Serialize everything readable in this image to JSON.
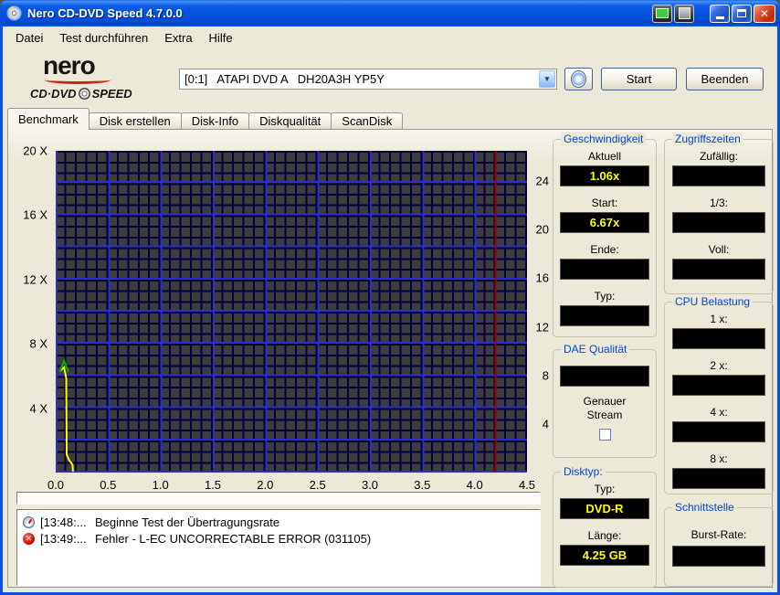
{
  "window": {
    "title": "Nero CD-DVD Speed 4.7.0.0"
  },
  "menu": {
    "items": [
      "Datei",
      "Test durchführen",
      "Extra",
      "Hilfe"
    ]
  },
  "logo": {
    "brand": "nero",
    "sub1": "CD·DVD",
    "sub2": "SPEED"
  },
  "toolbar": {
    "drive": "[0:1]   ATAPI DVD A   DH20A3H YP5Y",
    "start": "Start",
    "quit": "Beenden"
  },
  "tabs": [
    "Benchmark",
    "Disk erstellen",
    "Disk-Info",
    "Diskqualität",
    "ScanDisk"
  ],
  "colors": {
    "titlebar": "#0054e3",
    "group_caption": "#0046d5",
    "value_text": "#ffff00",
    "plot_background": "#3c3c3c",
    "grid_minor": "#00003c",
    "grid_major": "#2e2ec8",
    "error": "#c80000"
  },
  "chart_data": {
    "type": "line",
    "title": "",
    "x_axis": {
      "min": 0,
      "max": 4.5,
      "ticks": [
        {
          "label": "0.0",
          "value": 0.0
        },
        {
          "label": "0.5",
          "value": 0.5
        },
        {
          "label": "1.0",
          "value": 1.0
        },
        {
          "label": "1.5",
          "value": 1.5
        },
        {
          "label": "2.0",
          "value": 2.0
        },
        {
          "label": "2.5",
          "value": 2.5
        },
        {
          "label": "3.0",
          "value": 3.0
        },
        {
          "label": "3.5",
          "value": 3.5
        },
        {
          "label": "4.0",
          "value": 4.0
        },
        {
          "label": "4.5",
          "value": 4.5
        }
      ]
    },
    "left_axis": {
      "min": 0,
      "max": 20,
      "unit": "X",
      "ticks": [
        {
          "label": "20 X",
          "value": 20
        },
        {
          "label": "16 X",
          "value": 16
        },
        {
          "label": "12 X",
          "value": 12
        },
        {
          "label": "8 X",
          "value": 8
        },
        {
          "label": "4 X",
          "value": 4
        }
      ]
    },
    "right_axis": {
      "min": 0,
      "max": 26.5,
      "ticks": [
        {
          "label": "24",
          "value": 24
        },
        {
          "label": "20",
          "value": 20
        },
        {
          "label": "16",
          "value": 16
        },
        {
          "label": "12",
          "value": 12
        },
        {
          "label": "8",
          "value": 8
        },
        {
          "label": "4",
          "value": 4
        }
      ]
    },
    "series": [
      {
        "name": "transfer-rate",
        "color": "#ffff00",
        "points": [
          [
            0.04,
            6.3
          ],
          [
            0.08,
            6.55
          ],
          [
            0.1,
            5.85
          ],
          [
            0.105,
            1.1
          ],
          [
            0.13,
            0.75
          ],
          [
            0.16,
            0.5
          ],
          [
            0.165,
            0.05
          ]
        ]
      },
      {
        "name": "start-spike",
        "color": "#00b400",
        "points": [
          [
            0.04,
            6.3
          ],
          [
            0.08,
            6.95
          ],
          [
            0.12,
            6.25
          ]
        ]
      }
    ],
    "markers": [
      {
        "type": "vline",
        "value": 4.2,
        "color": "#a40000",
        "name": "disc-end-marker"
      }
    ]
  },
  "progress": {
    "value": 0
  },
  "log": [
    {
      "time": "[13:48:...",
      "message": "Beginne Test der Übertragungsrate",
      "icon": "test-start-icon"
    },
    {
      "time": "[13:49:...",
      "message": "Fehler - L-EC UNCORRECTABLE ERROR (031105)",
      "icon": "error-icon"
    }
  ],
  "panel": {
    "geschwindigkeit": {
      "title": "Geschwindigkeit",
      "rows": [
        {
          "label": "Aktuell",
          "value": "1.06x"
        },
        {
          "label": "Start:",
          "value": "6.67x"
        },
        {
          "label": "Ende:",
          "value": ""
        },
        {
          "label": "Typ:",
          "value": ""
        }
      ]
    },
    "zugriffszeiten": {
      "title": "Zugriffszeiten",
      "rows": [
        {
          "label": "Zufällig:",
          "value": ""
        },
        {
          "label": "1/3:",
          "value": ""
        },
        {
          "label": "Voll:",
          "value": ""
        }
      ]
    },
    "cpu": {
      "title": "CPU Belastung",
      "rows": [
        {
          "label": "1 x:",
          "value": ""
        },
        {
          "label": "2 x:",
          "value": ""
        },
        {
          "label": "4 x:",
          "value": ""
        },
        {
          "label": "8 x:",
          "value": ""
        }
      ]
    },
    "dae": {
      "title": "DAE Qualität",
      "value": "",
      "stream_label_1": "Genauer",
      "stream_label_2": "Stream",
      "checked": false
    },
    "disktyp": {
      "title": "Disktyp:",
      "rows": [
        {
          "label": "Typ:",
          "value": "DVD-R"
        },
        {
          "label": "Länge:",
          "value": "4.25 GB"
        }
      ]
    },
    "schnittstelle": {
      "title": "Schnittstelle",
      "label": "Burst-Rate:",
      "value": ""
    }
  }
}
